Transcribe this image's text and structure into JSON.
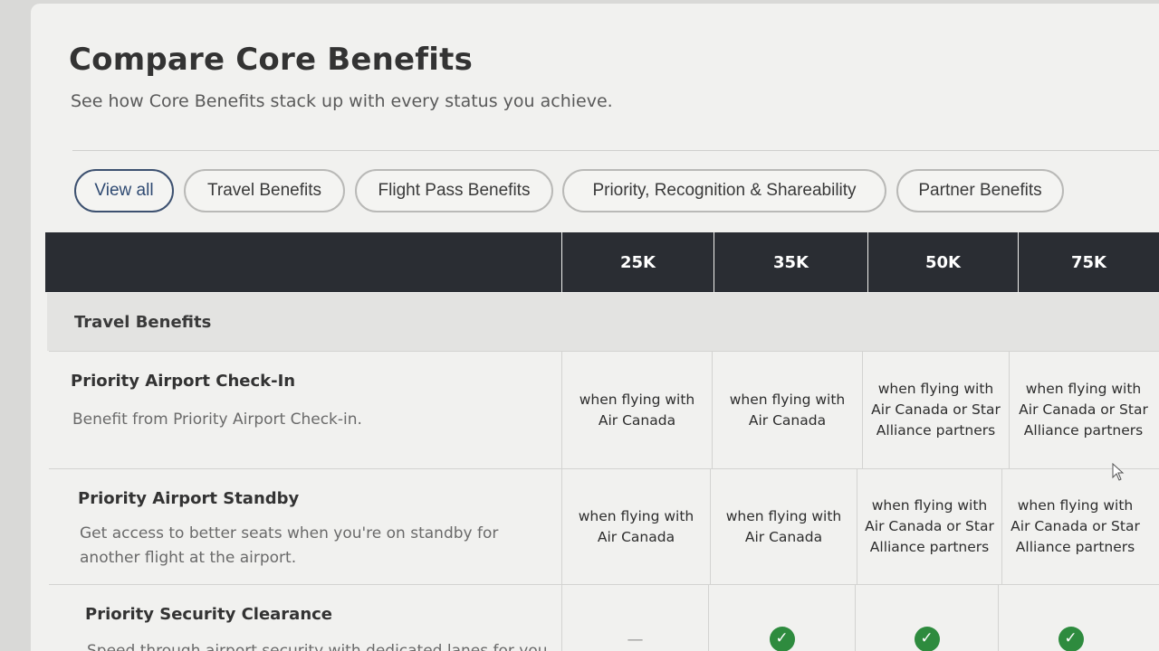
{
  "page": {
    "title": "Compare Core Benefits",
    "subtitle": "See how Core Benefits stack up with every status you achieve."
  },
  "filters": [
    {
      "label": "View all",
      "active": true
    },
    {
      "label": "Travel Benefits",
      "active": false
    },
    {
      "label": "Flight Pass Benefits",
      "active": false
    },
    {
      "label": "Priority, Recognition & Shareability",
      "active": false
    },
    {
      "label": "Partner Benefits",
      "active": false
    }
  ],
  "table": {
    "columns": [
      "25K",
      "35K",
      "50K",
      "75K"
    ],
    "section": "Travel Benefits",
    "rows": [
      {
        "name": "Priority Airport Check-In",
        "description": "Benefit from Priority Airport Check-in.",
        "values": [
          "when flying with Air Canada",
          "when flying with Air Canada",
          "when flying with Air Canada or Star Alliance partners",
          "when flying with Air Canada or Star Alliance partners"
        ]
      },
      {
        "name": "Priority Airport Standby",
        "description": "Get access to better seats when you're on standby for another flight at the airport.",
        "values": [
          "when flying with Air Canada",
          "when flying with Air Canada",
          "when flying with Air Canada or Star Alliance partners",
          "when flying with Air Canada or Star Alliance partners"
        ]
      },
      {
        "name": "Priority Security Clearance",
        "description": "Speed through airport security with dedicated lanes for you",
        "values": [
          "—",
          "check",
          "check",
          "check"
        ]
      }
    ]
  },
  "colors": {
    "header_bg": "#2a2d33",
    "active_pill": "#2f4a72",
    "check_green": "#2e8b3e"
  },
  "icons": [
    "check-icon",
    "cursor-icon"
  ]
}
